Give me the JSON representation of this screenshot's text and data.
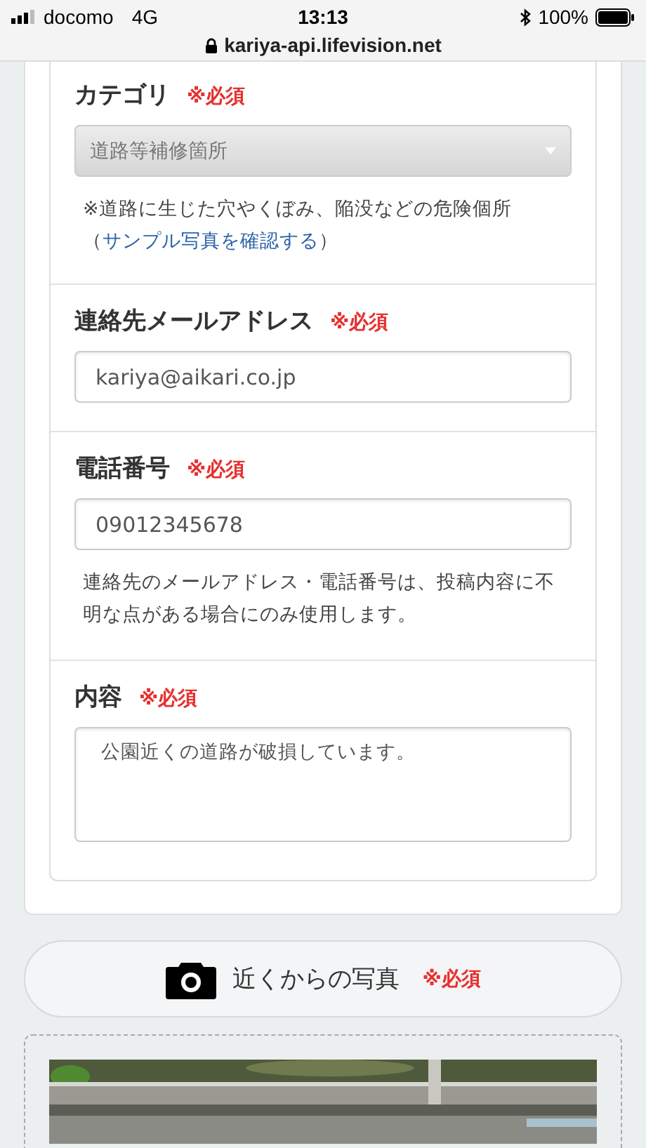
{
  "status_bar": {
    "carrier": "docomo",
    "network": "4G",
    "time": "13:13",
    "battery": "100%",
    "url": "kariya-api.lifevision.net"
  },
  "sections": [
    {
      "kind": "select",
      "label": "カテゴリ",
      "required": "※必須",
      "value": "道路等補修箇所",
      "note": "※道路に生じた穴やくぼみ、陥没などの危険個所",
      "link_before": "（",
      "link": "サンプル写真を確認する",
      "link_after": "）"
    },
    {
      "kind": "input",
      "label": "連絡先メールアドレス",
      "required": "※必須",
      "value": "kariya@aikari.co.jp"
    },
    {
      "kind": "input",
      "label": "電話番号",
      "required": "※必須",
      "value": "09012345678",
      "note": "連絡先のメールアドレス・電話番号は、投稿内容に不明な点がある場合にのみ使用します。"
    },
    {
      "kind": "textarea",
      "label": "内容",
      "required": "※必須",
      "value": "公園近くの道路が破損しています。"
    }
  ],
  "photo_button": {
    "label": "近くからの写真",
    "required": "※必須"
  }
}
